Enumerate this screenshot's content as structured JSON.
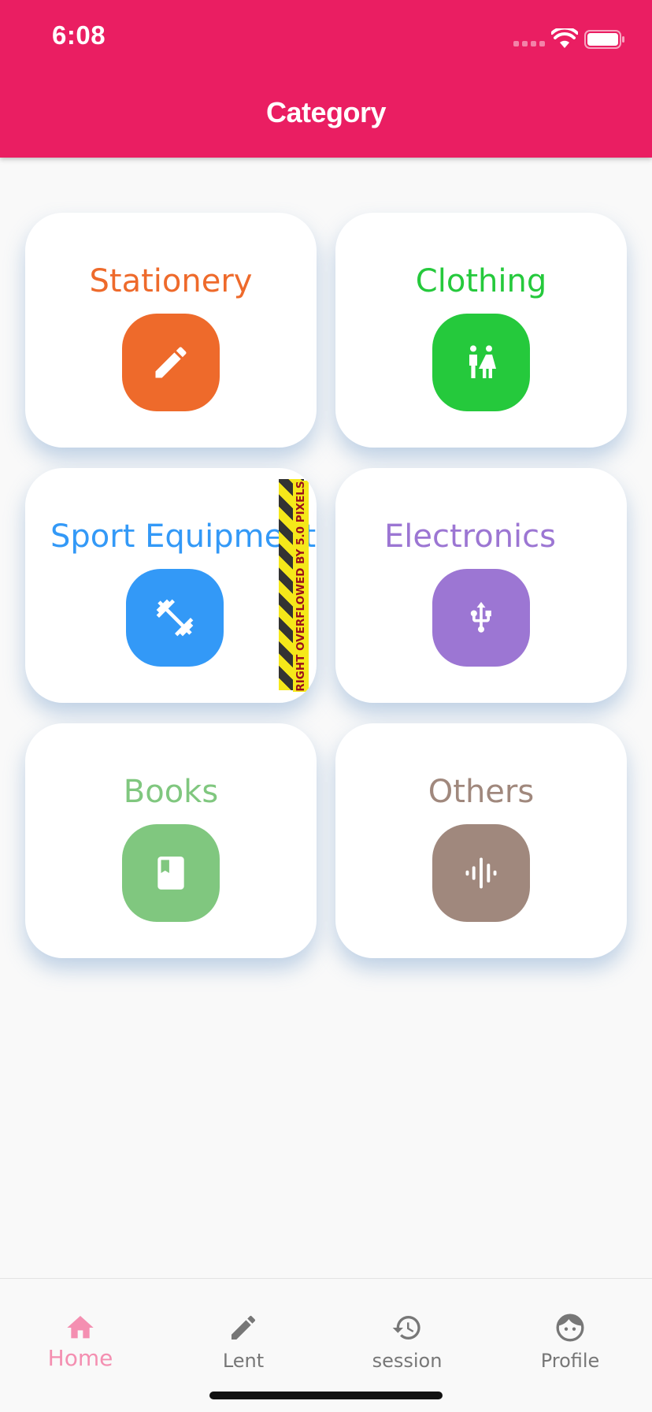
{
  "status_bar": {
    "time": "6:08",
    "icons": [
      "signal-icon",
      "wifi-icon",
      "battery-icon"
    ]
  },
  "app_bar": {
    "title": "Category",
    "background_color": "#ea1e62"
  },
  "categories": [
    {
      "label": "Stationery",
      "color": "#ee6a2b",
      "icon": "pencil-icon"
    },
    {
      "label": "Clothing",
      "color": "#25c93c",
      "icon": "people-icon"
    },
    {
      "label": "Sport Equipment",
      "color": "#3399f7",
      "icon": "dumbbell-icon"
    },
    {
      "label": "Electronics",
      "color": "#9c76d3",
      "icon": "usb-icon"
    },
    {
      "label": "Books",
      "color": "#80c77f",
      "icon": "book-icon"
    },
    {
      "label": "Others",
      "color": "#a0887d",
      "icon": "soundwave-icon"
    }
  ],
  "overflow_warning": {
    "text": "RIGHT OVERFLOWED BY 5.0 PIXELS"
  },
  "bottom_nav": {
    "active_color": "#f48fb1",
    "inactive_color": "#777777",
    "items": [
      {
        "label": "Home",
        "icon": "home-icon",
        "active": true
      },
      {
        "label": "Lent",
        "icon": "pencil-icon",
        "active": false
      },
      {
        "label": "session",
        "icon": "history-icon",
        "active": false
      },
      {
        "label": "Profile",
        "icon": "face-icon",
        "active": false
      }
    ]
  }
}
